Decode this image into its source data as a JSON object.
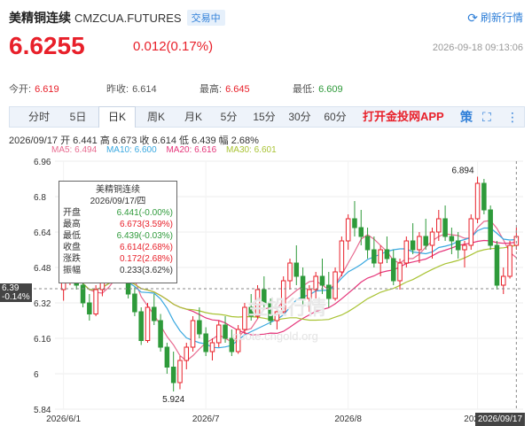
{
  "header": {
    "name": "美精铜连续",
    "code": "CMZCUA.FUTURES",
    "status": "交易中",
    "refresh_label": "刷新行情"
  },
  "quote": {
    "price": "6.6255",
    "change": "0.012(0.17%)",
    "time": "2026-09-18 09:13:06"
  },
  "stats": {
    "open_label": "今开:",
    "open": "6.619",
    "prev_label": "昨收:",
    "prev": "6.614",
    "high_label": "最高:",
    "high": "6.645",
    "low_label": "最低:",
    "low": "6.609"
  },
  "tabs": [
    "分时",
    "5日",
    "日K",
    "周K",
    "月K",
    "5分",
    "15分",
    "30分",
    "60分"
  ],
  "active_tab": "日K",
  "app_label": "打开金投网APP",
  "ohlc_line": "2026/09/17  开 6.441  高 6.673  收 6.614  低 6.439  幅 2.68%",
  "ma": {
    "ma5": "MA5: 6.494",
    "ma10": "MA10: 6.600",
    "ma20": "MA20: 6.616",
    "ma30": "MA30: 6.601"
  },
  "tooltip": {
    "title": "美精铜连续",
    "date": "2026/09/17/四",
    "rows": [
      {
        "k": "开盘",
        "v": "6.441(-0.00%)"
      },
      {
        "k": "最高",
        "v": "6.673(3.59%)"
      },
      {
        "k": "最低",
        "v": "6.439(-0.03%)"
      },
      {
        "k": "收盘",
        "v": "6.614(2.68%)"
      },
      {
        "k": "涨跌",
        "v": "0.172(2.68%)"
      },
      {
        "k": "振幅",
        "v": "0.233(3.62%)"
      }
    ]
  },
  "cursor_tag": {
    "price": "6.39",
    "pct": "-0.14%"
  },
  "date_tag": "2026/09/17",
  "watermark": "金投行情",
  "watermark_url": "quote.cngold.org",
  "colors": {
    "up": "#e8202a",
    "down": "#2e9a3a",
    "ma5": "#e86a8f",
    "ma10": "#39a8e0",
    "ma20": "#e5357a",
    "ma30": "#a9c334"
  },
  "chart_data": {
    "type": "candlestick",
    "y_ticks": [
      "6.96",
      "6.8",
      "6.64",
      "6.48",
      "6.32",
      "6.16",
      "6",
      "5.84"
    ],
    "ylim": [
      5.84,
      6.96
    ],
    "x_ticks": [
      "2026/6/1",
      "2026/7",
      "2026/8",
      "2026/9"
    ],
    "annotations": {
      "max": "6.894",
      "min": "5.924"
    },
    "candles": [
      [
        6.38,
        6.46,
        6.33,
        6.44
      ],
      [
        6.44,
        6.52,
        6.4,
        6.47
      ],
      [
        6.47,
        6.5,
        6.38,
        6.4
      ],
      [
        6.4,
        6.44,
        6.3,
        6.32
      ],
      [
        6.32,
        6.36,
        6.24,
        6.27
      ],
      [
        6.27,
        6.4,
        6.26,
        6.38
      ],
      [
        6.38,
        6.48,
        6.35,
        6.45
      ],
      [
        6.45,
        6.56,
        6.42,
        6.53
      ],
      [
        6.53,
        6.6,
        6.49,
        6.51
      ],
      [
        6.51,
        6.53,
        6.42,
        6.44
      ],
      [
        6.44,
        6.47,
        6.34,
        6.36
      ],
      [
        6.36,
        6.39,
        6.26,
        6.28
      ],
      [
        6.28,
        6.3,
        6.13,
        6.15
      ],
      [
        6.15,
        6.32,
        6.14,
        6.3
      ],
      [
        6.3,
        6.36,
        6.22,
        6.24
      ],
      [
        6.24,
        6.27,
        6.1,
        6.12
      ],
      [
        6.12,
        6.14,
        6.0,
        6.03
      ],
      [
        6.03,
        6.1,
        5.92,
        5.96
      ],
      [
        5.96,
        6.08,
        5.93,
        6.06
      ],
      [
        6.06,
        6.14,
        6.02,
        6.12
      ],
      [
        6.12,
        6.26,
        6.1,
        6.24
      ],
      [
        6.24,
        6.3,
        6.16,
        6.18
      ],
      [
        6.18,
        6.21,
        6.08,
        6.1
      ],
      [
        6.1,
        6.16,
        6.06,
        6.14
      ],
      [
        6.14,
        6.24,
        6.12,
        6.22
      ],
      [
        6.22,
        6.26,
        6.14,
        6.16
      ],
      [
        6.16,
        6.2,
        6.08,
        6.1
      ],
      [
        6.1,
        6.22,
        6.09,
        6.2
      ],
      [
        6.2,
        6.32,
        6.18,
        6.3
      ],
      [
        6.3,
        6.36,
        6.24,
        6.26
      ],
      [
        6.26,
        6.4,
        6.25,
        6.38
      ],
      [
        6.38,
        6.44,
        6.3,
        6.32
      ],
      [
        6.32,
        6.34,
        6.22,
        6.24
      ],
      [
        6.24,
        6.3,
        6.2,
        6.28
      ],
      [
        6.28,
        6.44,
        6.27,
        6.42
      ],
      [
        6.42,
        6.52,
        6.38,
        6.5
      ],
      [
        6.5,
        6.58,
        6.4,
        6.44
      ],
      [
        6.44,
        6.48,
        6.3,
        6.34
      ],
      [
        6.34,
        6.4,
        6.28,
        6.38
      ],
      [
        6.38,
        6.46,
        6.34,
        6.44
      ],
      [
        6.44,
        6.52,
        6.36,
        6.4
      ],
      [
        6.4,
        6.46,
        6.3,
        6.34
      ],
      [
        6.34,
        6.48,
        6.33,
        6.46
      ],
      [
        6.46,
        6.62,
        6.44,
        6.6
      ],
      [
        6.6,
        6.72,
        6.56,
        6.7
      ],
      [
        6.7,
        6.78,
        6.62,
        6.66
      ],
      [
        6.66,
        6.74,
        6.58,
        6.62
      ],
      [
        6.62,
        6.66,
        6.52,
        6.56
      ],
      [
        6.56,
        6.62,
        6.48,
        6.5
      ],
      [
        6.5,
        6.58,
        6.44,
        6.56
      ],
      [
        6.56,
        6.62,
        6.5,
        6.52
      ],
      [
        6.52,
        6.56,
        6.4,
        6.42
      ],
      [
        6.42,
        6.52,
        6.38,
        6.5
      ],
      [
        6.5,
        6.62,
        6.48,
        6.6
      ],
      [
        6.6,
        6.68,
        6.54,
        6.56
      ],
      [
        6.56,
        6.64,
        6.5,
        6.62
      ],
      [
        6.62,
        6.7,
        6.56,
        6.58
      ],
      [
        6.58,
        6.66,
        6.52,
        6.64
      ],
      [
        6.64,
        6.74,
        6.6,
        6.7
      ],
      [
        6.7,
        6.76,
        6.6,
        6.62
      ],
      [
        6.62,
        6.66,
        6.54,
        6.6
      ],
      [
        6.6,
        6.64,
        6.52,
        6.56
      ],
      [
        6.56,
        6.6,
        6.48,
        6.58
      ],
      [
        6.58,
        6.72,
        6.56,
        6.7
      ],
      [
        6.7,
        6.89,
        6.68,
        6.86
      ],
      [
        6.86,
        6.88,
        6.72,
        6.74
      ],
      [
        6.74,
        6.76,
        6.56,
        6.58
      ],
      [
        6.58,
        6.6,
        6.38,
        6.4
      ],
      [
        6.4,
        6.48,
        6.36,
        6.44
      ],
      [
        6.44,
        6.6,
        6.43,
        6.58
      ],
      [
        6.58,
        6.66,
        6.56,
        6.62
      ]
    ]
  }
}
